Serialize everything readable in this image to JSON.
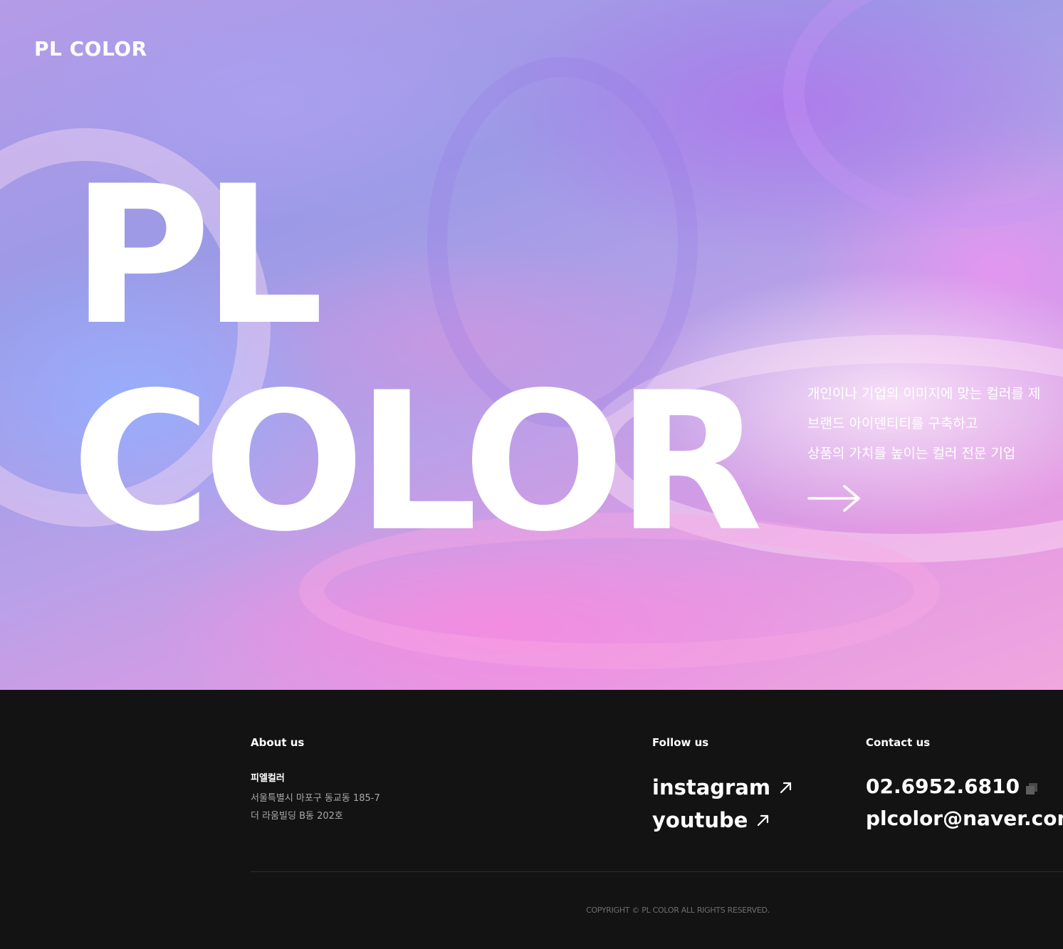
{
  "header": {
    "logo_text": "PL COLOR"
  },
  "hero": {
    "title_line1": "PL",
    "title_line2": "COLOR",
    "description": [
      "개인이나 기업의 이미지에 맞는 컬러를 제",
      "브랜드 아이덴티티를 구축하고",
      "상품의 가치를 높이는 컬러 전문 기업"
    ],
    "arrow_icon": "arrow-right-icon"
  },
  "footer": {
    "about": {
      "heading": "About us",
      "company_name": "피엘컬러",
      "address_line1": "서울특별시 마포구 동교동 185-7",
      "address_line2": "더 라움빌딩 B동 202호"
    },
    "follow": {
      "heading": "Follow us",
      "links": [
        {
          "label": "instagram",
          "icon": "arrow-up-right-icon"
        },
        {
          "label": "youtube",
          "icon": "arrow-up-right-icon"
        }
      ]
    },
    "contact": {
      "heading": "Contact us",
      "phone": "02.6952.6810",
      "phone_icon": "copy-icon",
      "email": "plcolor@naver.com"
    },
    "copyright": "COPYRIGHT © PL COLOR ALL RIGHTS RESERVED."
  },
  "colors": {
    "footer_background": "#131313",
    "text_primary": "#ffffff",
    "text_muted": "#a9a9a9",
    "copyright_text": "#6e6e6e"
  }
}
